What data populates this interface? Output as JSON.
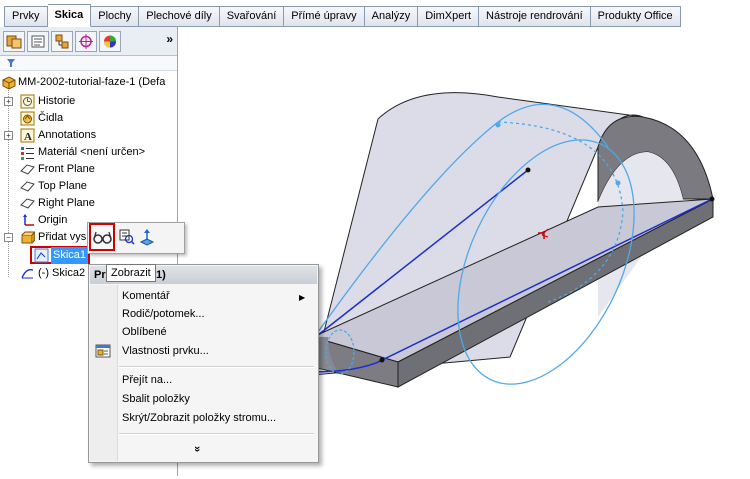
{
  "tabs": [
    {
      "label": "Prvky",
      "active": false
    },
    {
      "label": "Skica",
      "active": true
    },
    {
      "label": "Plochy",
      "active": false
    },
    {
      "label": "Plechové díly",
      "active": false
    },
    {
      "label": "Svařování",
      "active": false
    },
    {
      "label": "Přímé úpravy",
      "active": false
    },
    {
      "label": "Analýzy",
      "active": false
    },
    {
      "label": "DimXpert",
      "active": false
    },
    {
      "label": "Nástroje rendrování",
      "active": false
    },
    {
      "label": "Produkty Office",
      "active": false
    }
  ],
  "panel": {
    "more_label": "»",
    "tree": {
      "root": "MM-2002-tutorial-faze-1  (Defa",
      "historie": "Historie",
      "cidla": "Čidla",
      "annotations": "Annotations",
      "material": "Materiál <není určen>",
      "front_plane": "Front Plane",
      "top_plane": "Top Plane",
      "right_plane": "Right Plane",
      "origin": "Origin",
      "pridat": "Přidat vys",
      "skica1": "Skica1",
      "skica2": "(-) Skica2"
    }
  },
  "context_toolbar": {
    "tooltip": "Zobrazit"
  },
  "context_menu": {
    "header_left": "Pr",
    "header_right": "1)",
    "items": {
      "komentar": "Komentář",
      "rodic": "Rodič/potomek...",
      "oblibene": "Oblíbené",
      "vlastnosti": "Vlastnosti prvku...",
      "prejit": "Přejít na...",
      "sbalit": "Sbalit položky",
      "skryt": "Skrýt/Zobrazit položky stromu..."
    },
    "expand_glyph": "»"
  },
  "colors": {
    "selection_red": "#d00000",
    "sketch_blue": "#1a2fcf",
    "sketch_light_blue": "#4fa8e8",
    "model_face": "#d8d8e6"
  }
}
